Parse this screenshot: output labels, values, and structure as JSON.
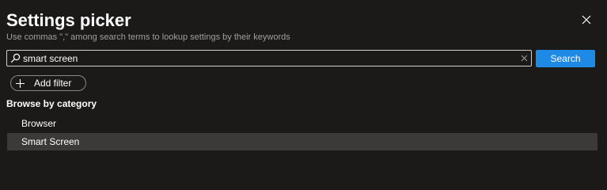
{
  "panel": {
    "title": "Settings picker",
    "subtitle": "Use commas \",\" among search terms to lookup settings by their keywords"
  },
  "search": {
    "value": "smart screen",
    "button_label": "Search"
  },
  "filter": {
    "add_label": "Add filter"
  },
  "browse": {
    "heading": "Browse by category",
    "categories": [
      {
        "label": "Browser",
        "selected": false
      },
      {
        "label": "Smart Screen",
        "selected": true
      }
    ]
  },
  "colors": {
    "background": "#1b1a19",
    "accent": "#1f8ae6",
    "selected_row": "#3b3a39",
    "subtle_text": "#a19f9d"
  },
  "icons": {
    "close": "close-icon",
    "search": "search-icon",
    "clear": "clear-icon",
    "add": "plus-icon"
  }
}
